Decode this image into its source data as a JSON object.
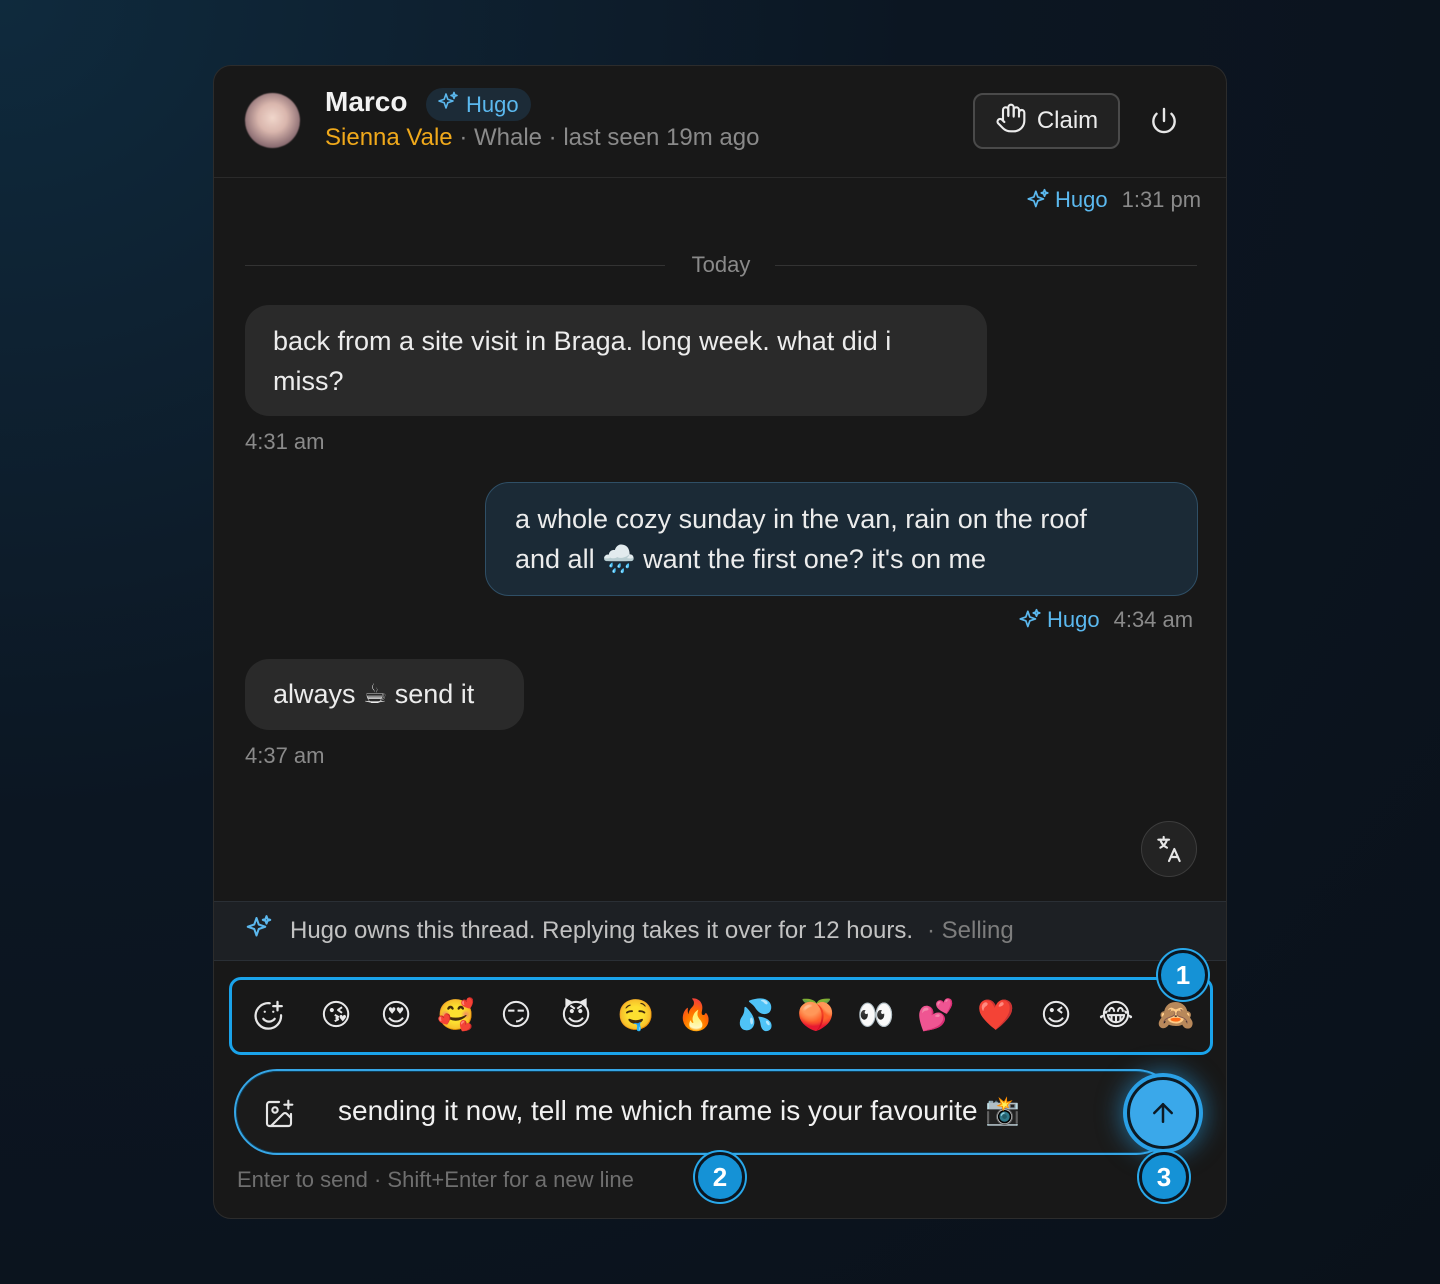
{
  "header": {
    "contact_name": "Marco",
    "agent_badge": "Hugo",
    "owner": "Sienna Vale",
    "status_text": "· Whale · last seen 19m ago",
    "claim_label": "Claim"
  },
  "thread": {
    "top_meta": {
      "agent": "Hugo",
      "time": "1:31 pm"
    },
    "day_divider": "Today",
    "messages": [
      {
        "direction": "in",
        "text_line1": "back from a site visit in Braga. long week. what did i",
        "text_line2": "miss?",
        "time": "4:31 am"
      },
      {
        "direction": "out",
        "text_line1": "a whole cozy sunday in the van, rain on the roof",
        "text_line2": "and all 🌧️ want the first one? it's on me",
        "agent": "Hugo",
        "time": "4:34 am"
      },
      {
        "direction": "in",
        "text_line1": "always ☕ send it",
        "time": "4:37 am"
      }
    ]
  },
  "notice": {
    "text": "Hugo owns this thread. Replying takes it over for 12 hours.",
    "mode": "· Selling"
  },
  "emoji_bar": [
    "😘",
    "😍",
    "🥰",
    "😏",
    "😈",
    "🤤",
    "🔥",
    "💦",
    "🍑",
    "👀",
    "💕",
    "❤️",
    "😉",
    "😂",
    "🙈"
  ],
  "composer": {
    "value": "sending it now, tell me which frame is your favourite 📸",
    "hint": "Enter to send · Shift+Enter for a new line"
  },
  "markers": [
    "1",
    "2",
    "3"
  ],
  "colors": {
    "accent": "#1aa3ea",
    "agent": "#5bb8ee",
    "owner": "#f0a91b"
  }
}
